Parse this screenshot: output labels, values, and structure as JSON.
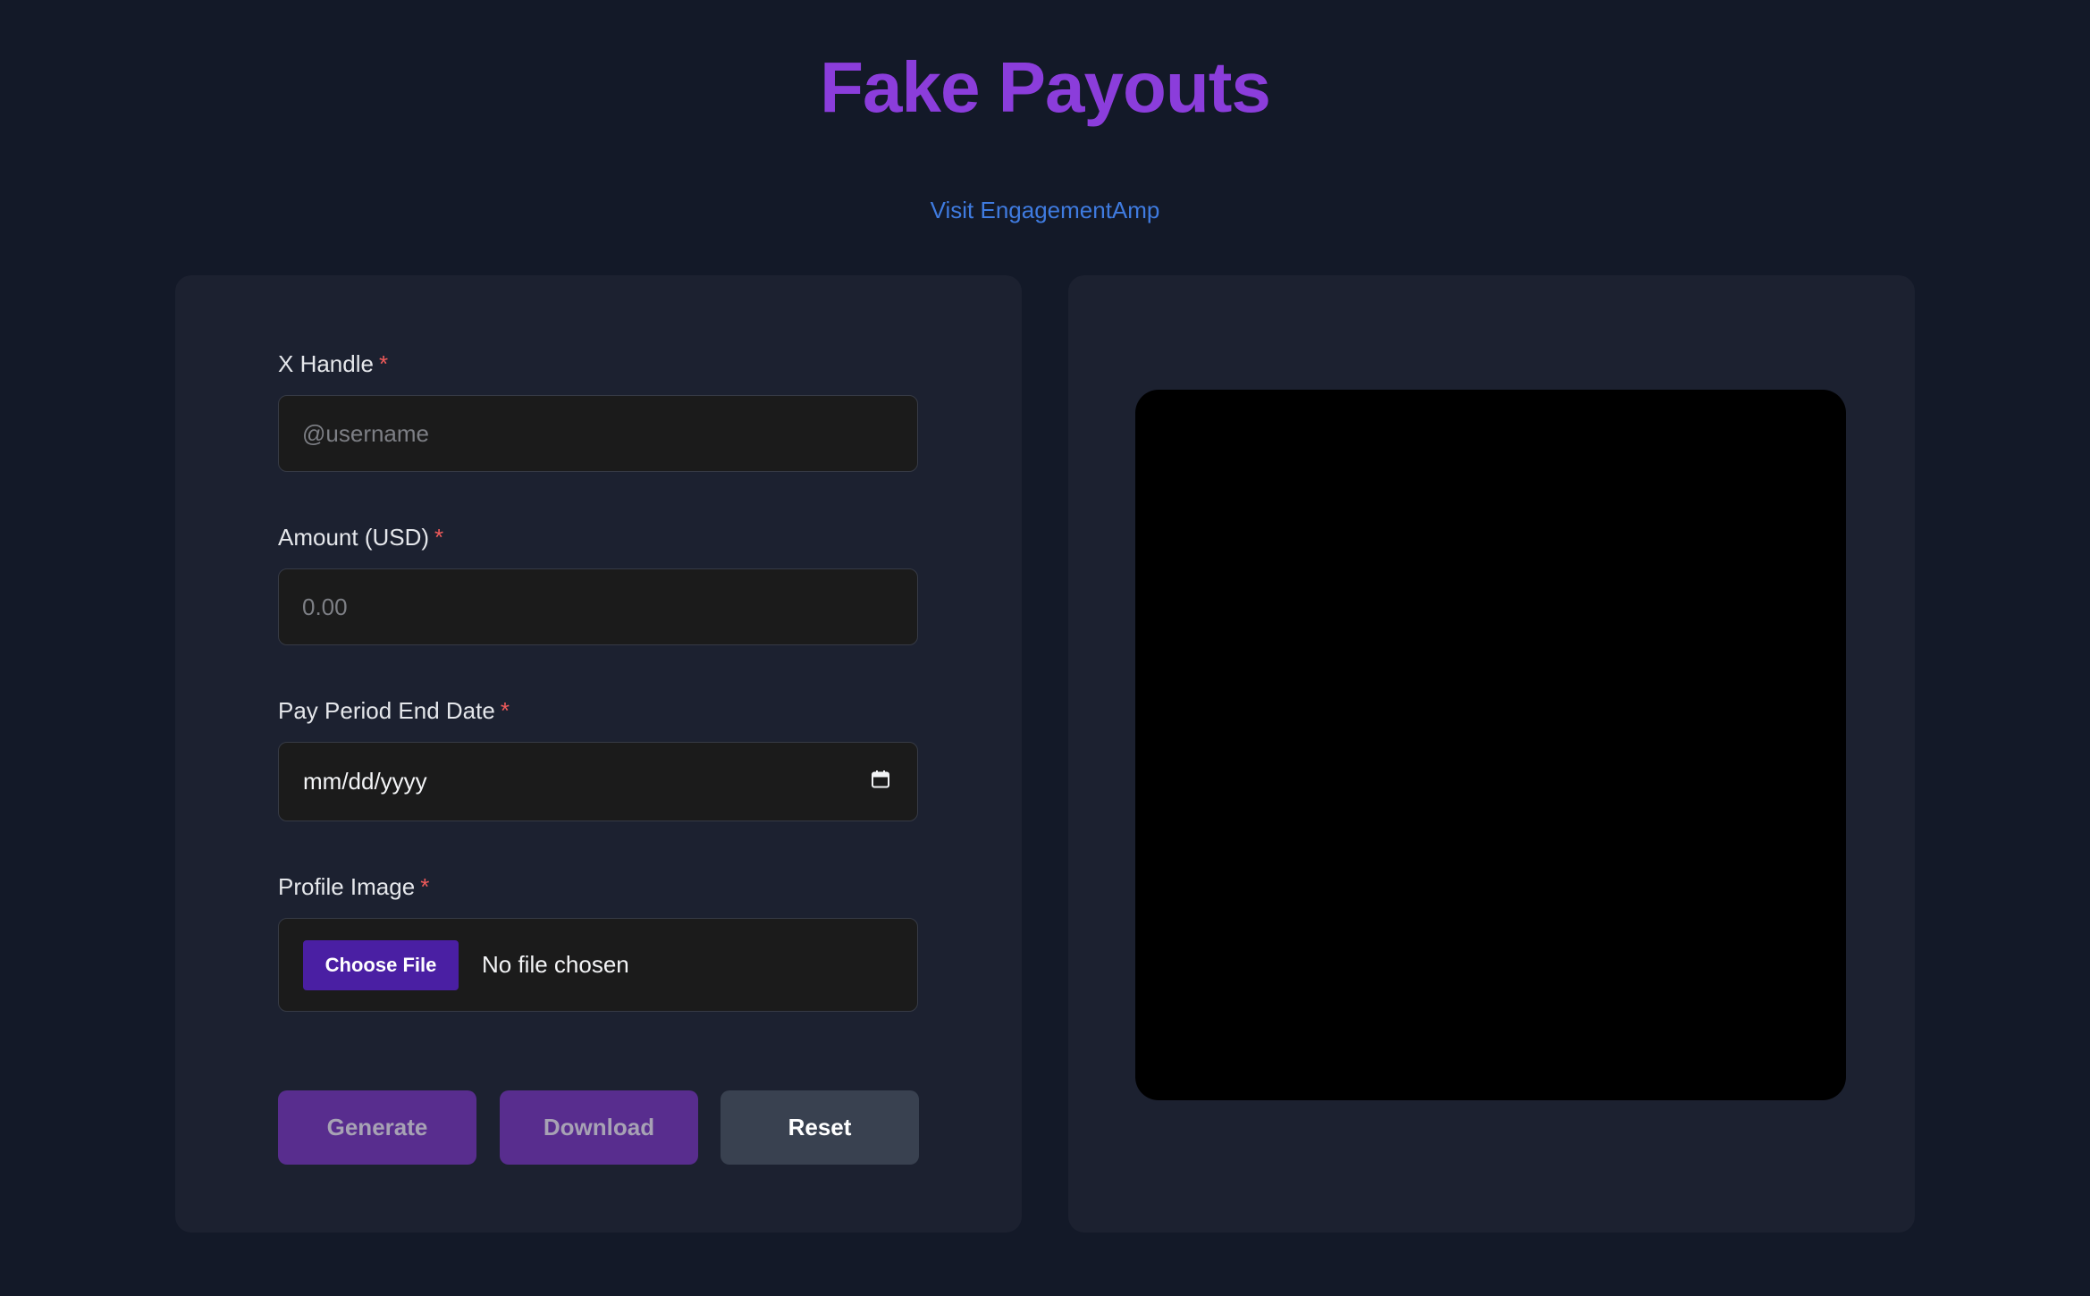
{
  "header": {
    "title": "Fake Payouts",
    "link_text": "Visit EngagementAmp"
  },
  "form": {
    "handle": {
      "label": "X Handle",
      "required_mark": "*",
      "placeholder": "@username",
      "value": ""
    },
    "amount": {
      "label": "Amount (USD)",
      "required_mark": "*",
      "placeholder": "0.00",
      "value": ""
    },
    "end_date": {
      "label": "Pay Period End Date",
      "required_mark": "*",
      "display_value": "mm/dd/yyyy",
      "icon": "calendar-icon"
    },
    "profile_image": {
      "label": "Profile Image",
      "required_mark": "*",
      "button_label": "Choose File",
      "status": "No file chosen"
    }
  },
  "actions": {
    "generate_label": "Generate",
    "download_label": "Download",
    "reset_label": "Reset"
  },
  "colors": {
    "background": "#131928",
    "panel": "#1c2130",
    "title": "#8b3ddb",
    "link": "#3f7be0",
    "required": "#ef5a5a",
    "primary_button_disabled": "#582d8e",
    "reset_button": "#394150",
    "choose_file_button": "#4a1fa3",
    "preview": "#000000"
  }
}
